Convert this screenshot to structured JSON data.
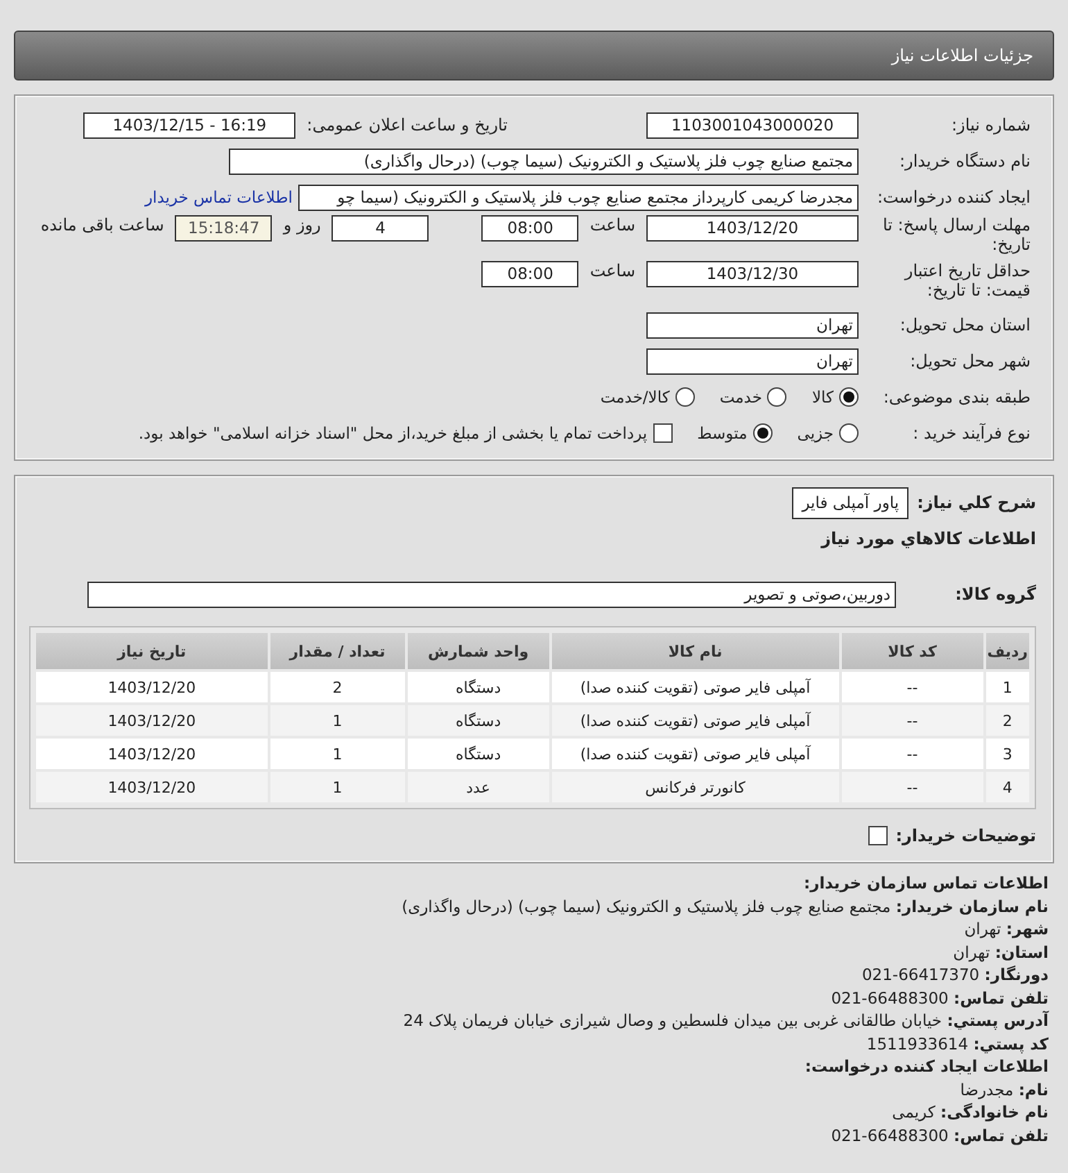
{
  "header": {
    "title": "جزئیات اطلاعات نیاز"
  },
  "details": {
    "need_number": {
      "label": "شماره نیاز:",
      "value": "1103001043000020"
    },
    "announce": {
      "label": "تاریخ و ساعت اعلان عمومی:",
      "value": "1403/12/15 - 16:19"
    },
    "buyer_org": {
      "label": "نام دستگاه خریدار:",
      "value": "مجتمع  صنایع چوب  فلز  پلاستیک و الکترونیک (سیما چوب) (درحال واگذاری)"
    },
    "requester": {
      "label": "ایجاد کننده درخواست:",
      "value": "مجدرضا کریمی کارپرداز مجتمع  صنایع چوب  فلز  پلاستیک و الکترونیک (سیما چو",
      "link": "اطلاعات تماس خریدار"
    },
    "deadline": {
      "label": "مهلت ارسال پاسخ: تا تاریخ:",
      "date": "1403/12/20",
      "time_label": "ساعت",
      "time": "08:00",
      "days": "4",
      "days_label": "روز و",
      "remaining": "15:18:47",
      "remaining_label": "ساعت باقی مانده"
    },
    "validity": {
      "label": "حداقل تاریخ اعتبار قیمت: تا تاریخ:",
      "date": "1403/12/30",
      "time_label": "ساعت",
      "time": "08:00"
    },
    "province": {
      "label": "استان محل تحویل:",
      "value": "تهران"
    },
    "city": {
      "label": "شهر محل تحویل:",
      "value": "تهران"
    },
    "category": {
      "label": "طبقه بندی موضوعی:",
      "options": [
        {
          "label": "کالا",
          "selected": true
        },
        {
          "label": "خدمت",
          "selected": false
        },
        {
          "label": "کالا/خدمت",
          "selected": false
        }
      ]
    },
    "process": {
      "label": "نوع فرآیند خرید :",
      "options": [
        {
          "label": "جزیی",
          "selected": false
        },
        {
          "label": "متوسط",
          "selected": true
        }
      ],
      "treasury": {
        "checked": false,
        "text": "پرداخت تمام یا بخشی از مبلغ خرید،از محل \"اسناد خزانه اسلامی\" خواهد بود."
      }
    }
  },
  "need": {
    "summary": {
      "label": "شرح کلي نياز:",
      "value": "پاور آمپلی فایر"
    },
    "goods_heading": "اطلاعات کالاهاي مورد نياز",
    "group": {
      "label": "گروه کالا:",
      "value": "دوربین،صوتی و تصویر"
    },
    "table": {
      "columns": [
        "ردیف",
        "کد کالا",
        "نام کالا",
        "واحد شمارش",
        "تعداد / مقدار",
        "تاریخ نیاز"
      ],
      "rows": [
        [
          "1",
          "--",
          "آمپلی فایر صوتی (تقویت کننده صدا)",
          "دستگاه",
          "2",
          "1403/12/20"
        ],
        [
          "2",
          "--",
          "آمپلی فایر صوتی (تقویت کننده صدا)",
          "دستگاه",
          "1",
          "1403/12/20"
        ],
        [
          "3",
          "--",
          "آمپلی فایر صوتی (تقویت کننده صدا)",
          "دستگاه",
          "1",
          "1403/12/20"
        ],
        [
          "4",
          "--",
          "کانورتر فرکانس",
          "عدد",
          "1",
          "1403/12/20"
        ]
      ]
    },
    "buyer_notes": {
      "label": "توضیحات خریدار:",
      "checked": false
    }
  },
  "contact": {
    "heading": "اطلاعات تماس سازمان خریدار:",
    "lines": [
      "**نام سازمان خریدار:** مجتمع صنایع چوب فلز پلاستیک و الکترونیک (سیما چوب) (درحال واگذاری)",
      "**شهر:** تهران",
      "**استان:** تهران",
      "**دورنگار:** 66417370-021",
      "**تلفن تماس:** 66488300-021",
      "**آدرس پستي:** خیابان طالقانی غربی بین میدان فلسطین و وصال شیرازی خیابان فریمان پلاک 24",
      "**کد پستي:** 1511933614"
    ],
    "creator_heading": "اطلاعات ایجاد کننده درخواست:",
    "creator_lines": [
      "**نام:** مجدرضا",
      "**نام خانوادگی:** کریمی",
      "**تلفن تماس:** 66488300-021"
    ]
  }
}
